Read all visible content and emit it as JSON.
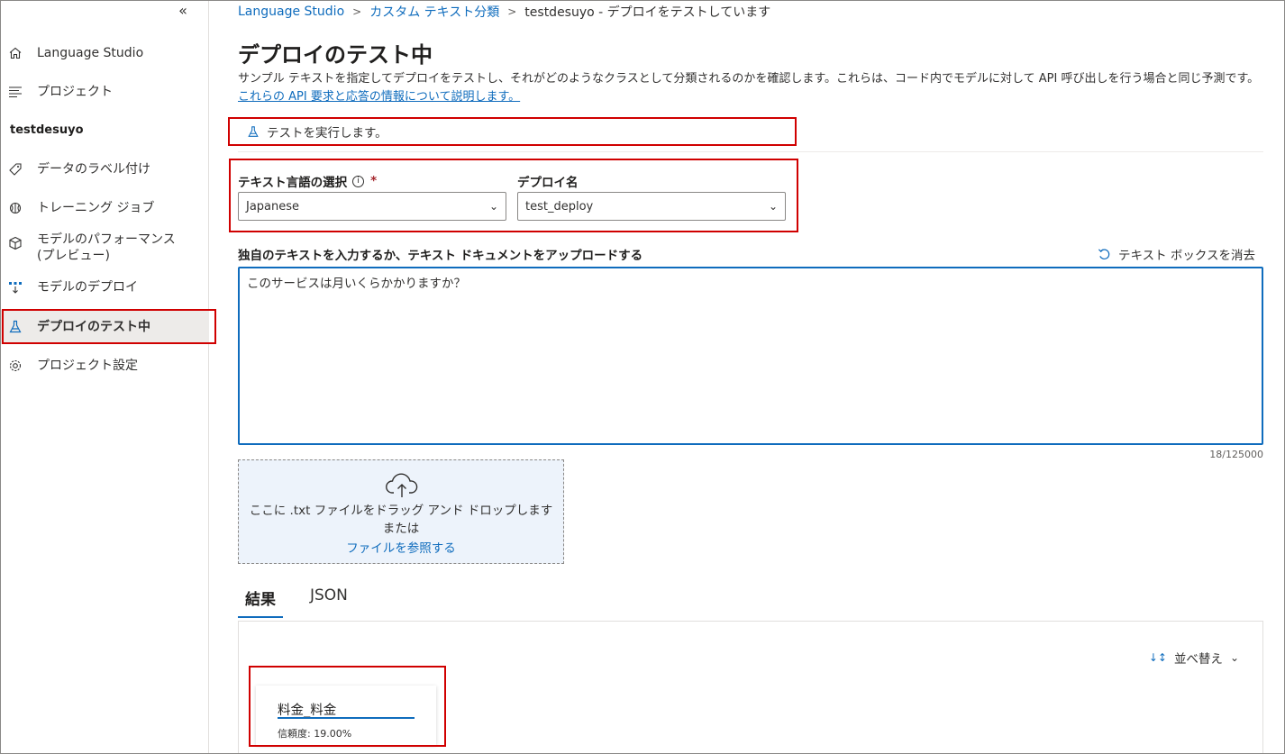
{
  "sidebar": {
    "collapse_icon": "«",
    "items": [
      {
        "label": "Language Studio",
        "icon": "home-icon"
      },
      {
        "label": "プロジェクト",
        "icon": "list-icon"
      },
      {
        "label": "データのラベル付け",
        "icon": "tag-icon"
      },
      {
        "label": "トレーニング ジョブ",
        "icon": "brain-icon"
      },
      {
        "label": "モデルのパフォーマンス (プレビュー)",
        "icon": "cube-icon"
      },
      {
        "label": "モデルのデプロイ",
        "icon": "deploy-icon"
      },
      {
        "label": "デプロイのテスト中",
        "icon": "flask-icon"
      },
      {
        "label": "プロジェクト設定",
        "icon": "gear-icon"
      }
    ],
    "project_name": "testdesuyo"
  },
  "breadcrumb": {
    "items": [
      "Language Studio",
      "カスタム テキスト分類"
    ],
    "current": "testdesuyo - デプロイをテストしています"
  },
  "page": {
    "title": "デプロイのテスト中",
    "description": "サンプル テキストを指定してデプロイをテストし、それがどのようなクラスとして分類されるのかを確認します。これらは、コード内でモデルに対して API 呼び出しを行う場合と同じ予測です。",
    "description_link": "これらの API 要求と応答の情報について説明します。",
    "run_test_label": "テストを実行します。"
  },
  "form": {
    "language_label": "テキスト言語の選択",
    "language_value": "Japanese",
    "required_marker": "*",
    "info_icon": "i",
    "deployment_label": "デプロイ名",
    "deployment_value": "test_deploy",
    "text_label": "独自のテキストを入力するか、テキスト ドキュメントをアップロードする",
    "clear_label": "テキスト ボックスを消去",
    "text_value": "このサービスは月いくらかかりますか？",
    "char_count": "18/125000"
  },
  "upload": {
    "line1": "ここに .txt ファイルをドラッグ アンド ドロップします",
    "line2": "または",
    "browse_link": "ファイルを参照する"
  },
  "results": {
    "tabs": [
      "結果",
      "JSON"
    ],
    "sort_label": "並べ替え",
    "card": {
      "class_name": "料金_料金",
      "confidence": "信頼度: 19.00%",
      "confidence_value": 0.19
    }
  },
  "colors": {
    "accent": "#0f6cbd",
    "highlight_box": "#d00000"
  }
}
